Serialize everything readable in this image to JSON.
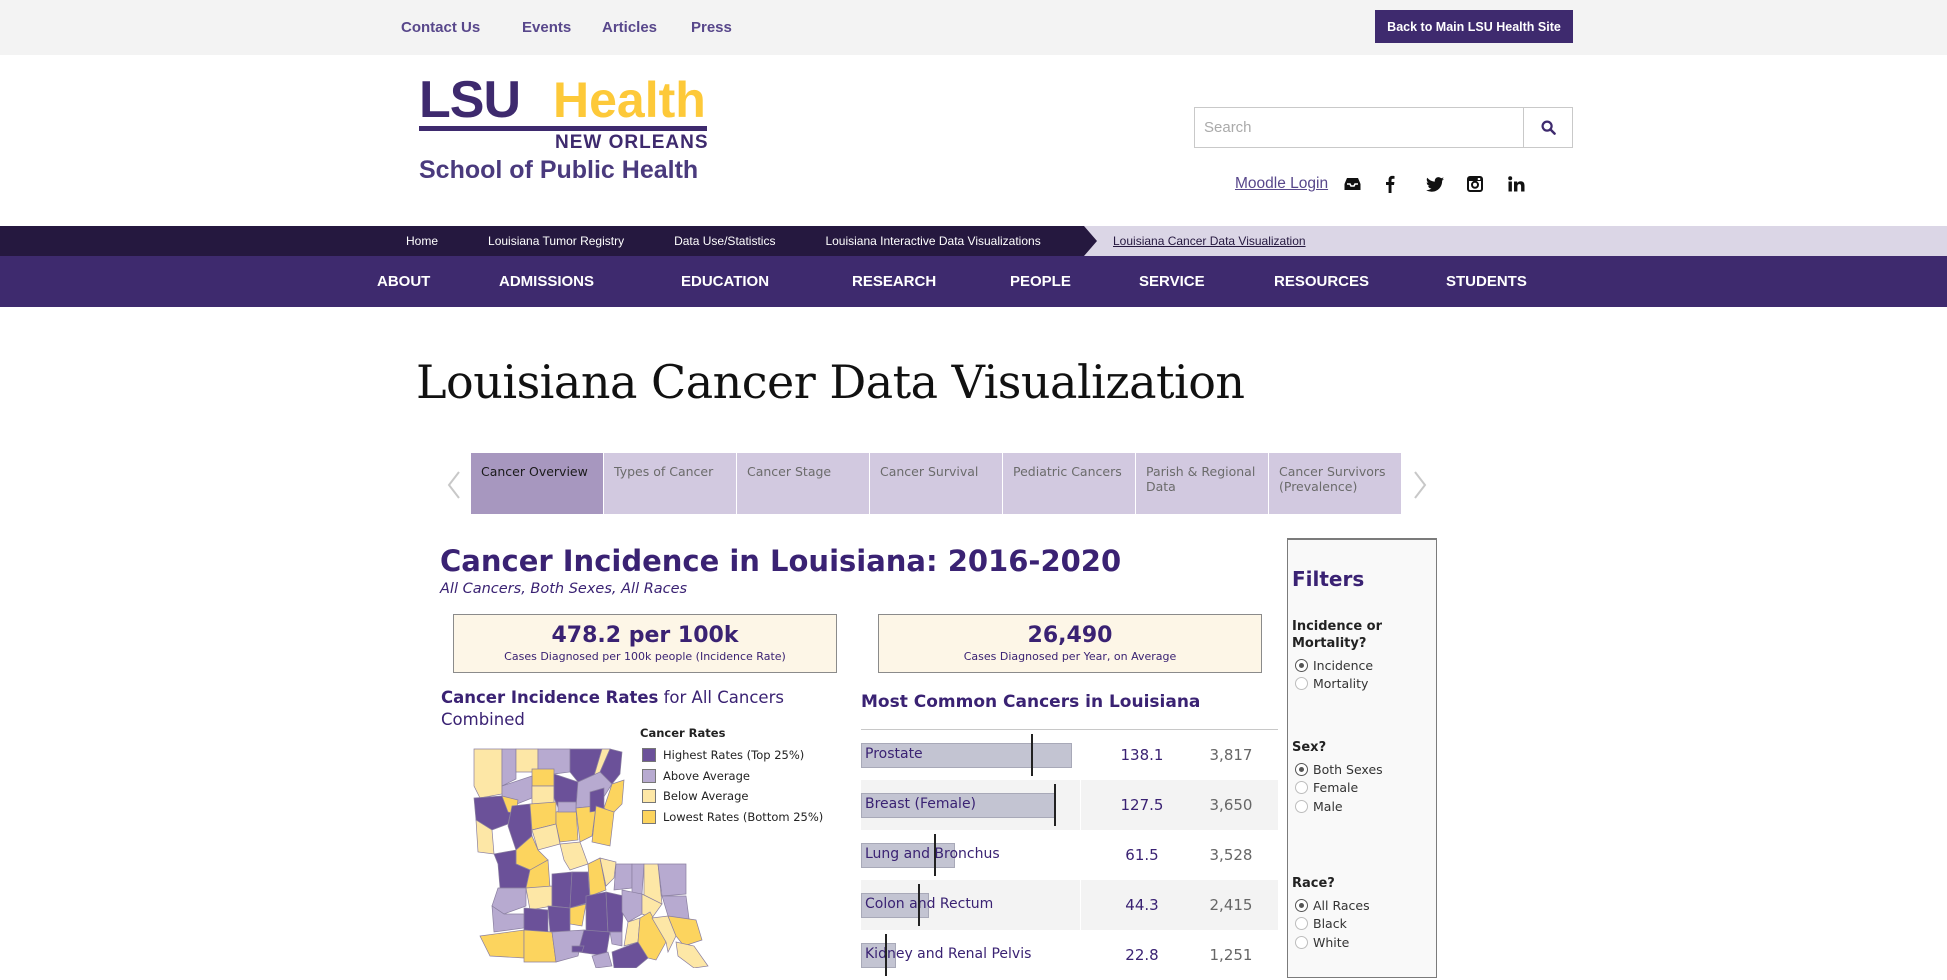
{
  "utility": {
    "links": [
      "Contact Us",
      "Events",
      "Articles",
      "Press"
    ],
    "back_button": "Back to Main LSU Health Site"
  },
  "logo": {
    "lsu": "LSU",
    "health": "Health",
    "city": "NEW ORLEANS",
    "school": "School of Public Health"
  },
  "search": {
    "placeholder": "Search",
    "value": "",
    "icon": "search-icon"
  },
  "social": {
    "moodle": "Moodle Login",
    "icons": [
      "inbox-icon",
      "facebook-icon",
      "twitter-icon",
      "instagram-icon",
      "linkedin-icon"
    ]
  },
  "breadcrumb": {
    "items": [
      "Home",
      "Louisiana Tumor Registry",
      "Data Use/Statistics",
      "Louisiana Interactive Data Visualizations"
    ],
    "current": "Louisiana Cancer Data Visualization"
  },
  "nav": {
    "items": [
      "ABOUT",
      "ADMISSIONS",
      "EDUCATION",
      "RESEARCH",
      "PEOPLE",
      "SERVICE",
      "RESOURCES",
      "STUDENTS"
    ]
  },
  "page_title": "Louisiana Cancer Data Visualization",
  "tabs": [
    {
      "label": "Cancer Overview",
      "active": true
    },
    {
      "label": "Types of Cancer",
      "active": false
    },
    {
      "label": "Cancer Stage",
      "active": false
    },
    {
      "label": "Cancer Survival",
      "active": false
    },
    {
      "label": "Pediatric Cancers",
      "active": false
    },
    {
      "label": "Parish & Regional Data",
      "active": false
    },
    {
      "label": "Cancer Survivors (Prevalence)",
      "active": false
    }
  ],
  "dashboard": {
    "title": "Cancer Incidence in Louisiana: 2016-2020",
    "subtitle": "All Cancers, Both Sexes, All Races",
    "stats": [
      {
        "value": "478.2 per 100k",
        "caption": "Cases Diagnosed per 100k people (Incidence Rate)"
      },
      {
        "value": "26,490",
        "caption": "Cases Diagnosed per Year, on Average"
      }
    ],
    "map": {
      "title_bold": "Cancer Incidence Rates",
      "title_rest": " for All Cancers Combined",
      "legend_title": "Cancer Rates",
      "legend": [
        {
          "label": "Highest Rates (Top 25%)",
          "color": "#6b5199"
        },
        {
          "label": "Above Average",
          "color": "#b7aad0"
        },
        {
          "label": "Below Average",
          "color": "#fde7a6"
        },
        {
          "label": "Lowest Rates (Bottom 25%)",
          "color": "#fcd45e"
        }
      ]
    },
    "most_common": {
      "title": "Most Common Cancers in Louisiana",
      "rows": [
        {
          "name": "Prostate",
          "rate": "138.1",
          "count": "3,817",
          "rate_value": 138.1,
          "marker_value": 111
        },
        {
          "name": "Breast (Female)",
          "rate": "127.5",
          "count": "3,650",
          "rate_value": 127.5,
          "marker_value": 126
        },
        {
          "name": "Lung and Bronchus",
          "rate": "61.5",
          "count": "3,528",
          "rate_value": 61.5,
          "marker_value": 48
        },
        {
          "name": "Colon and Rectum",
          "rate": "44.3",
          "count": "2,415",
          "rate_value": 44.3,
          "marker_value": 37
        },
        {
          "name": "Kidney and Renal Pelvis",
          "rate": "22.8",
          "count": "1,251",
          "rate_value": 22.8,
          "marker_value": 16
        }
      ]
    }
  },
  "filters": {
    "title": "Filters",
    "groups": [
      {
        "question": "Incidence or Mortality?",
        "options": [
          "Incidence",
          "Mortality"
        ],
        "selected": 0
      },
      {
        "question": "Sex?",
        "options": [
          "Both Sexes",
          "Female",
          "Male"
        ],
        "selected": 0
      },
      {
        "question": "Race?",
        "options": [
          "All Races",
          "Black",
          "White"
        ],
        "selected": 0
      }
    ]
  }
}
